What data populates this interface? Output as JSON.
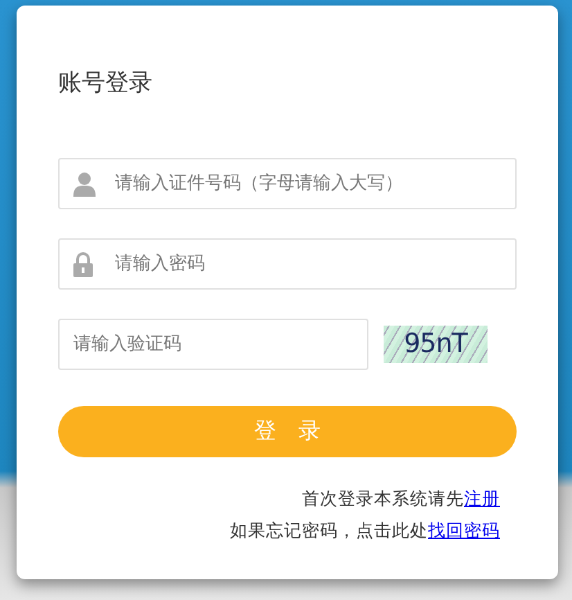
{
  "title": "账号登录",
  "fields": [
    {
      "kind": "user",
      "placeholder": "请输入证件号码（字母请输入大写）"
    },
    {
      "kind": "lock",
      "placeholder": "请输入密码"
    }
  ],
  "captcha": {
    "placeholder": "请输入验证码",
    "code": "95nT"
  },
  "login_button": "登　录",
  "links": [
    {
      "text": "首次登录本系统请先",
      "link": "注册"
    },
    {
      "text": "如果忘记密码，点击此处",
      "link": "找回密码"
    }
  ]
}
